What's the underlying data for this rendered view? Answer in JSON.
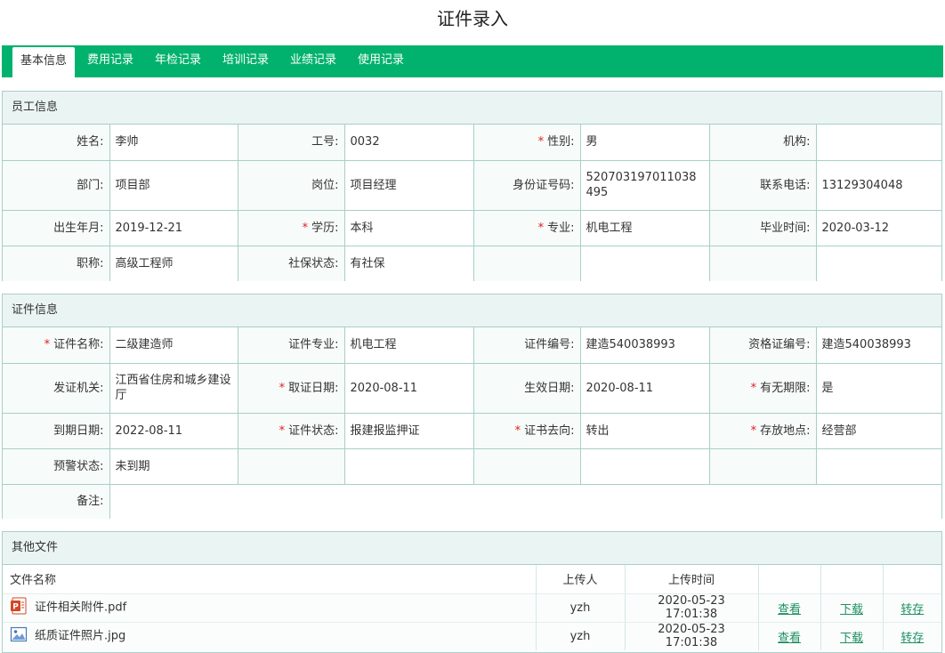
{
  "page": {
    "title": "证件录入"
  },
  "tabs": [
    {
      "label": "基本信息"
    },
    {
      "label": "费用记录"
    },
    {
      "label": "年检记录"
    },
    {
      "label": "培训记录"
    },
    {
      "label": "业绩记录"
    },
    {
      "label": "使用记录"
    }
  ],
  "employee": {
    "section_title": "员工信息",
    "name_label": "姓名:",
    "name": "李帅",
    "empno_label": "工号:",
    "empno": "0032",
    "gender_label": "性别:",
    "gender": "男",
    "org_label": "机构:",
    "org": "",
    "dept_label": "部门:",
    "dept": "项目部",
    "position_label": "岗位:",
    "position": "项目经理",
    "idcard_label": "身份证号码:",
    "idcard": "520703197011038495",
    "phone_label": "联系电话:",
    "phone": "13129304048",
    "birth_label": "出生年月:",
    "birth": "2019-12-21",
    "edu_label": "学历:",
    "edu": "本科",
    "major_label": "专业:",
    "major": "机电工程",
    "grad_label": "毕业时间:",
    "grad": "2020-03-12",
    "title_label": "职称:",
    "title": "高级工程师",
    "social_label": "社保状态:",
    "social": "有社保"
  },
  "certificate": {
    "section_title": "证件信息",
    "name_label": "证件名称:",
    "name": "二级建造师",
    "major_label": "证件专业:",
    "major": "机电工程",
    "number_label": "证件编号:",
    "number": "建造540038993",
    "qual_label": "资格证编号:",
    "qual": "建造540038993",
    "issuer_label": "发证机关:",
    "issuer": "江西省住房和城乡建设厅",
    "obtain_label": "取证日期:",
    "obtain": "2020-08-11",
    "effective_label": "生效日期:",
    "effective": "2020-08-11",
    "validity_label": "有无期限:",
    "validity": "是",
    "expire_label": "到期日期:",
    "expire": "2022-08-11",
    "status_label": "证件状态:",
    "status": "报建报监押证",
    "whereabouts_label": "证书去向:",
    "whereabouts": "转出",
    "location_label": "存放地点:",
    "location": "经营部",
    "warn_label": "预警状态:",
    "warn": "未到期",
    "remark_label": "备注:",
    "remark": ""
  },
  "required_mark": "*",
  "files": {
    "section_title": "其他文件",
    "headers": {
      "name": "文件名称",
      "uploader": "上传人",
      "time": "上传时间"
    },
    "rows": [
      {
        "icon": "pdf-file-icon",
        "name": "证件相关附件.pdf",
        "uploader": "yzh",
        "time": "2020-05-23 17:01:38",
        "view": "查看",
        "download": "下载",
        "save": "转存"
      },
      {
        "icon": "image-file-icon",
        "name": "纸质证件照片.jpg",
        "uploader": "yzh",
        "time": "2020-05-23 17:01:38",
        "view": "查看",
        "download": "下载",
        "save": "转存"
      }
    ]
  },
  "colors": {
    "accent": "#00b26d",
    "border": "#a9cfc8",
    "header_bg": "#eaf4f3",
    "required": "#e02020",
    "link": "#1e8f62"
  }
}
